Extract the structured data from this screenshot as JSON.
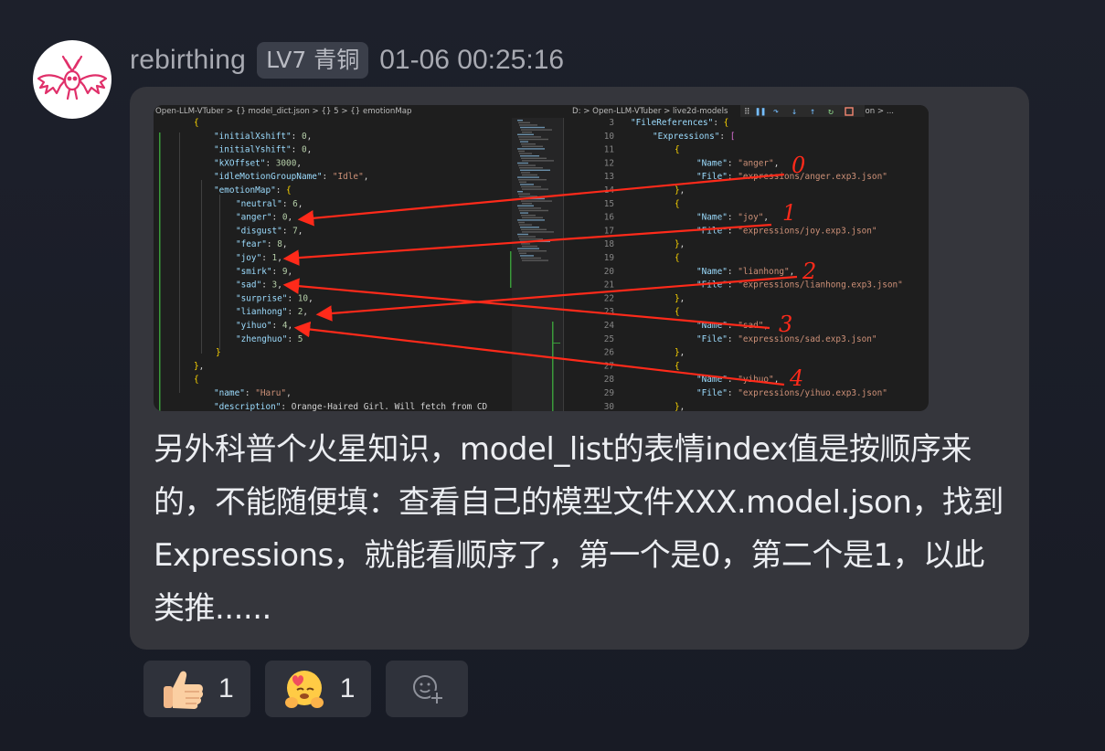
{
  "user": {
    "name": "rebirthing",
    "level": "LV7 青铜",
    "timestamp": "01-06 00:25:16"
  },
  "message": {
    "text": "另外科普个火星知识，model_list的表情index值是按顺序来的，不能随便填：查看自己的模型文件XXX.model.json，找到Expressions，就能看顺序了，第一个是0，第二个是1，以此类推......"
  },
  "screenshot": {
    "left_breadcrumb": "Open-LLM-VTuber > {} model_dict.json > {} 5 > {} emotionMap",
    "right_breadcrumb": "D: > Open-LLM-VTuber > live2d-models",
    "right_breadcrumb_tail": "son > ...",
    "left_lines": [
      "{",
      "\"initialXshift\": 0,",
      "\"initialYshift\": 0,",
      "\"kXOffset\": 3000,",
      "\"idleMotionGroupName\": \"Idle\",",
      "\"emotionMap\": {",
      "\"neutral\": 6,",
      "\"anger\": 0,",
      "\"disgust\": 7,",
      "\"fear\": 8,",
      "\"joy\": 1,",
      "\"smirk\": 9,",
      "\"sad\": 3,",
      "\"surprise\": 10,",
      "\"lianhong\": 2,",
      "\"yihuo\": 4,",
      "\"zhenghuo\": 5",
      "}",
      "},",
      "{",
      "\"name\": \"Haru\",",
      "\"description\": \"Orange-Haired Girl. Will fetch from CD"
    ],
    "right_line_numbers": [
      "3",
      "10",
      "11",
      "12",
      "13",
      "14",
      "15",
      "16",
      "17",
      "18",
      "19",
      "20",
      "21",
      "22",
      "23",
      "24",
      "25",
      "26",
      "27",
      "28",
      "29",
      "30"
    ],
    "right_lines": [
      "\"FileReferences\": {",
      "\"Expressions\": [",
      "{",
      "\"Name\": \"anger\",",
      "\"File\": \"expressions/anger.exp3.json\"",
      "},",
      "{",
      "\"Name\": \"joy\",",
      "\"File\": \"expressions/joy.exp3.json\"",
      "},",
      "{",
      "\"Name\": \"lianhong\",",
      "\"File\": \"expressions/lianhong.exp3.json\"",
      "},",
      "{",
      "\"Name\": \"sad\",",
      "\"File\": \"expressions/sad.exp3.json\"",
      "},",
      "{",
      "\"Name\": \"yihuo\",",
      "\"File\": \"expressions/yihuo.exp3.json\"",
      "},"
    ],
    "annotations": [
      "0",
      "1",
      "2",
      "3",
      "4"
    ]
  },
  "reactions": [
    {
      "emoji": "thumbs-up",
      "count": "1"
    },
    {
      "emoji": "hugging-face",
      "count": "1"
    }
  ],
  "colors": {
    "background": "#1b1e28",
    "bubble": "#35363c",
    "code_bg": "#1e1e1e",
    "string": "#ce9178",
    "key": "#9cdcfe",
    "number": "#b5cea8",
    "annotation": "#ff2a1a"
  }
}
